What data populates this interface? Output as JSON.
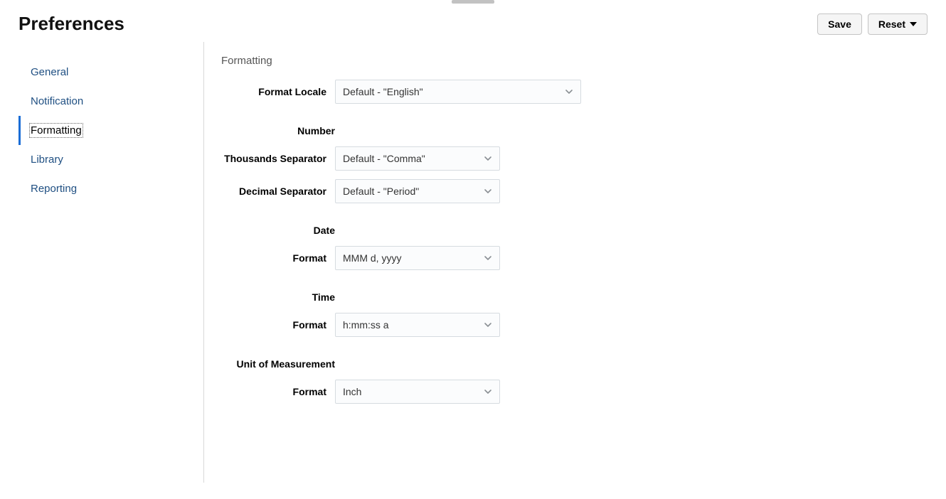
{
  "page_title": "Preferences",
  "actions": {
    "save_label": "Save",
    "reset_label": "Reset"
  },
  "sidebar": {
    "items": [
      {
        "label": "General",
        "active": false
      },
      {
        "label": "Notification",
        "active": false
      },
      {
        "label": "Formatting",
        "active": true
      },
      {
        "label": "Library",
        "active": false
      },
      {
        "label": "Reporting",
        "active": false
      }
    ]
  },
  "formatting": {
    "section_title": "Formatting",
    "locale_label": "Format Locale",
    "locale_value": "Default - \"English\"",
    "number": {
      "heading": "Number",
      "thousands_label": "Thousands Separator",
      "thousands_value": "Default - \"Comma\"",
      "decimal_label": "Decimal Separator",
      "decimal_value": "Default - \"Period\""
    },
    "date": {
      "heading": "Date",
      "format_label": "Format",
      "format_value": "MMM d, yyyy"
    },
    "time": {
      "heading": "Time",
      "format_label": "Format",
      "format_value": "h:mm:ss a"
    },
    "unit": {
      "heading": "Unit of Measurement",
      "format_label": "Format",
      "format_value": "Inch"
    }
  }
}
